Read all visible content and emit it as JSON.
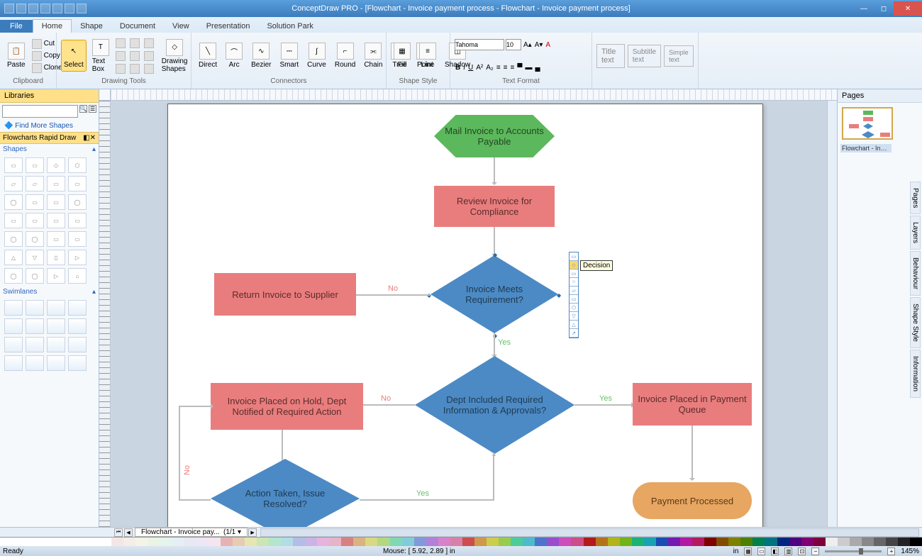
{
  "title": "ConceptDraw PRO - [Flowchart - Invoice payment process - Flowchart - Invoice payment process]",
  "tabs": {
    "file": "File",
    "home": "Home",
    "shape": "Shape",
    "document": "Document",
    "view": "View",
    "presentation": "Presentation",
    "solution": "Solution Park"
  },
  "ribbon": {
    "clipboard": {
      "paste": "Paste",
      "cut": "Cut",
      "copy": "Copy",
      "clone": "Clone",
      "label": "Clipboard"
    },
    "drawing": {
      "select": "Select",
      "textbox": "Text Box",
      "drawshapes": "Drawing Shapes",
      "label": "Drawing Tools"
    },
    "connectors": {
      "direct": "Direct",
      "arc": "Arc",
      "bezier": "Bezier",
      "smart": "Smart",
      "curve": "Curve",
      "round": "Round",
      "chain": "Chain",
      "tree": "Tree",
      "point": "Point",
      "label": "Connectors"
    },
    "shapestyle": {
      "fill": "Fill",
      "line": "Line",
      "shadow": "Shadow",
      "label": "Shape Style"
    },
    "textformat": {
      "label": "Text Format",
      "font": "Tahoma",
      "size": "10",
      "titletext": "Title text",
      "subtitletext": "Subtitle text",
      "simpletext": "Simple text"
    }
  },
  "libraries": {
    "title": "Libraries",
    "find": "Find More Shapes",
    "rapid": "Flowcharts Rapid Draw",
    "shapes": "Shapes",
    "swim": "Swimlanes"
  },
  "pages": {
    "title": "Pages",
    "page1": "Flowchart - Invoice..."
  },
  "sidetabs": {
    "pages": "Pages",
    "layers": "Layers",
    "behaviour": "Behaviour",
    "style": "Shape Style",
    "info": "Information"
  },
  "pagetab": {
    "name": "Flowchart - Invoice pay...",
    "counter": "(1/1"
  },
  "status": {
    "ready": "Ready",
    "mouse": "Mouse: [ 5.92, 2.89 ] in",
    "unit": "in",
    "zoom": "145%"
  },
  "flow": {
    "n1": "Mail Invoice to Accounts Payable",
    "n2": "Review Invoice for Compliance",
    "n3": "Invoice Meets Requirement?",
    "n4": "Return Invoice to Supplier",
    "n5": "Dept Included Required Information & Approvals?",
    "n6": "Invoice Placed on Hold, Dept Notified of Required Action",
    "n7": "Invoice Placed in Payment Queue",
    "n8": "Action Taken, Issue Resolved?",
    "n9": "Payment Processed",
    "yes": "Yes",
    "no": "No"
  },
  "tooltip": "Decision"
}
